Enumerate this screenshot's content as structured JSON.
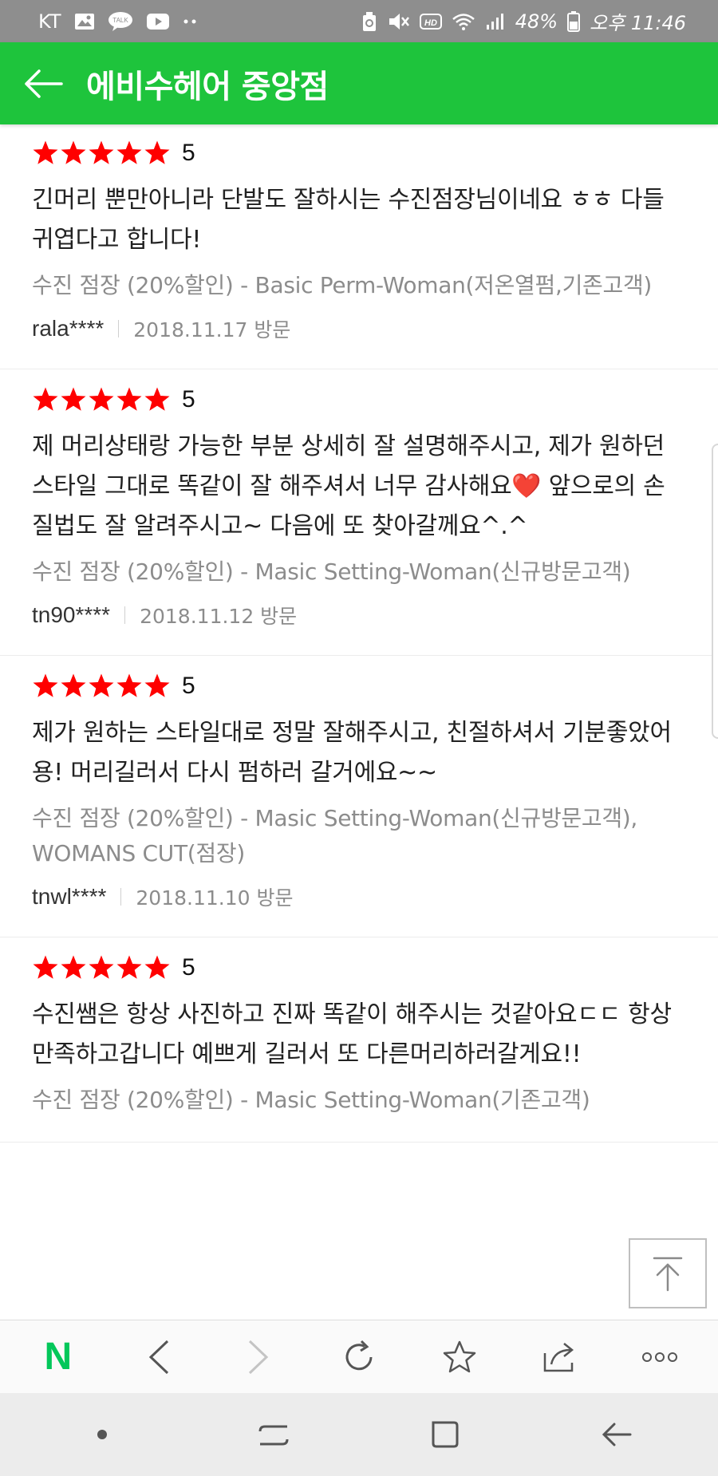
{
  "status_bar": {
    "carrier": "KT",
    "battery": "48%",
    "time": "오후 11:46"
  },
  "header": {
    "title": "에비수헤어 중앙점"
  },
  "reviews": [
    {
      "rating": "5",
      "text": "긴머리 뿐만아니라 단발도 잘하시는 수진점장님이네요 ㅎㅎ 다들 귀엽다고 합니다!",
      "service": "수진 점장 (20%할인) - Basic Perm-Woman(저온열펌,기존고객)",
      "user": "rala****",
      "date": "2018.11.17 방문"
    },
    {
      "rating": "5",
      "text": "제 머리상태랑 가능한 부분 상세히 잘 설명해주시고, 제가 원하던 스타일 그대로 똑같이 잘 해주셔서 너무 감사해요❤️ 앞으로의 손질법도 잘 알려주시고~ 다음에 또 찾아갈께요^.^",
      "service": "수진 점장 (20%할인) - Masic Setting-Woman(신규방문고객)",
      "user": "tn90****",
      "date": "2018.11.12 방문"
    },
    {
      "rating": "5",
      "text": "제가 원하는 스타일대로 정말 잘해주시고, 친절하셔서 기분좋았어용! 머리길러서 다시 펌하러 갈거에요~~",
      "service": "수진 점장 (20%할인) - Masic Setting-Woman(신규방문고객), WOMANS CUT(점장)",
      "user": "tnwl****",
      "date": "2018.11.10 방문"
    },
    {
      "rating": "5",
      "text": "수진쌤은 항상 사진하고 진짜 똑같이 해주시는 것같아요ㄷㄷ 항상 만족하고갑니다 예쁘게 길러서 또 다른머리하러갈게요!!",
      "service": "수진 점장 (20%할인) - Masic Setting-Woman(기존고객)",
      "user": "",
      "date": ""
    }
  ],
  "toolbar": {
    "home_letter": "N"
  },
  "icons": {
    "back": "arrow-left-icon",
    "top": "scroll-to-top-icon",
    "star": "star-icon"
  },
  "colors": {
    "brand_green": "#1ec43c",
    "star_red": "#ff0000",
    "naver_green": "#03c75a"
  }
}
